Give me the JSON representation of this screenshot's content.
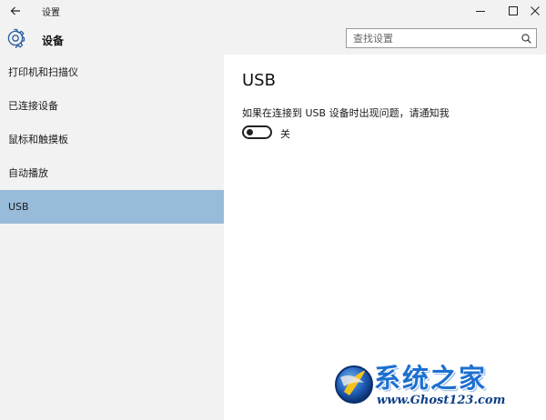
{
  "window": {
    "title": "设置"
  },
  "header": {
    "page_title": "设备",
    "search": {
      "placeholder": "查找设置",
      "value": ""
    }
  },
  "sidebar": {
    "items": [
      {
        "label": "打印机和扫描仪",
        "selected": false
      },
      {
        "label": "已连接设备",
        "selected": false
      },
      {
        "label": "鼠标和触摸板",
        "selected": false
      },
      {
        "label": "自动播放",
        "selected": false
      },
      {
        "label": "USB",
        "selected": true
      }
    ]
  },
  "content": {
    "section_title": "USB",
    "setting": {
      "description": "如果在连接到 USB 设备时出现问题，请通知我",
      "toggle_state": "关",
      "toggle_on": false
    }
  },
  "watermark": {
    "title": "系统之家",
    "url": "www.Ghost123.com"
  },
  "colors": {
    "chrome_bg": "#f2f2f2",
    "selected_item": "#98bbd9",
    "content_bg": "#ffffff",
    "watermark_blue": "#1d6fd0"
  },
  "icons": {
    "back": "back-arrow-icon",
    "minimize": "minimize-icon",
    "maximize": "maximize-icon",
    "close": "close-icon",
    "devices": "gear-icon",
    "search": "search-icon"
  }
}
